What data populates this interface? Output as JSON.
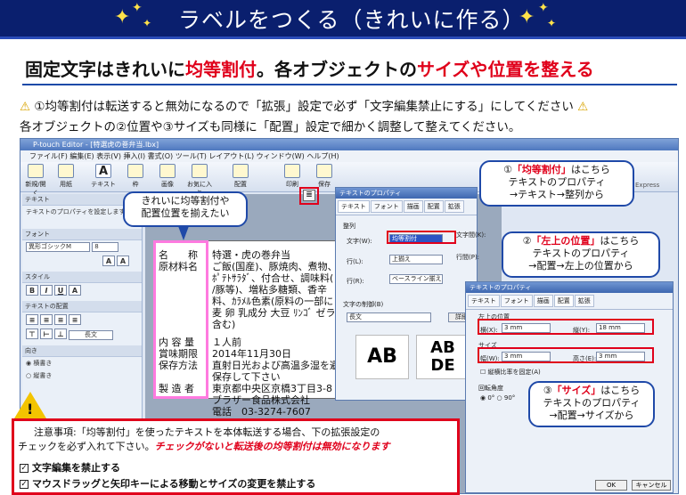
{
  "header": {
    "title": "ラベルをつくる（きれいに作る）"
  },
  "subtitle": {
    "part1": "固定文字はきれいに",
    "part2": "均等割付",
    "part3": "。各オブジェクトの",
    "part4": "サイズや位置を整える"
  },
  "warning": {
    "line1": "①均等割付は転送すると無効になるので「拡張」設定で必ず「文字編集禁止にする」にしてください",
    "line2": "各オブジェクトの②位置や③サイズも同様に「配置」設定で細かく調整して整えてください。"
  },
  "app": {
    "title": "P-touch Editor - [特選虎の巻弁当.lbx]",
    "menu": "ファイル(F)  編集(E)  表示(V)  挿入(I)  書式(O)  ツール(T)  レイアウト(L)  ウィンドウ(W)  ヘルプ(H)",
    "toolbar": [
      "新規/開く",
      "用紙",
      "テキスト",
      "枠",
      "画像",
      "お気に入り",
      "配置",
      "印刷",
      "保存"
    ],
    "toolbar_right": "Express",
    "sidebar": {
      "text_head": "テキスト",
      "text_desc": "テキストのプロパティを設定します",
      "font_head": "フォント",
      "font_name": "異形ゴシックM",
      "font_size": "8",
      "style_head": "スタイル",
      "align_head": "テキストの配置",
      "long": "長文",
      "dir_head": "向き",
      "dir1": "横書き",
      "dir2": "縦書き"
    },
    "label": {
      "c1": [
        "名　　称",
        "原材料名"
      ],
      "c2": [
        "特選・虎の巻弁当",
        "ご飯(国産)、豚焼肉、煮物、",
        "ﾎﾟﾃﾄｻﾗﾀﾞ、付合せ、調味料(",
        "/豚等)、増粘多糖類、香辛",
        "料、ｶﾗﾒﾙ色素(原料の一部に",
        "麦 卵 乳成分 大豆 ﾘﾝｺﾞ ゼラ",
        "含む)"
      ],
      "c3": [
        "内 容 量",
        "賞味期限",
        "保存方法",
        "",
        "製 造 者"
      ],
      "c4": [
        "１人前",
        "2014年11月30日",
        "直射日光および高温多湿を避",
        "保存して下さい",
        "東京都中央区京橋3丁目3-8",
        "ブラザー食品株式会社",
        "電話　03-3274-7607"
      ]
    }
  },
  "callouts": {
    "c0": "きれいに均等割付や\n配置位置を揃えたい",
    "c1_a": "①",
    "c1_b": "「均等割付」",
    "c1_c": "はこちら",
    "c1_d": "テキストのプロパティ",
    "c1_e": "→テキスト→整列から",
    "c2_a": "②",
    "c2_b": "「左上の位置」",
    "c2_c": "はこちら",
    "c2_d": "テキストのプロパティ",
    "c2_e": "→配置→左上の位置から",
    "c3_a": "③",
    "c3_b": "「サイズ」",
    "c3_c": "はこちら",
    "c3_d": "テキストのプロパティ",
    "c3_e": "→配置→サイズから"
  },
  "dialog1": {
    "title": "テキストのプロパティ",
    "tabs": [
      "テキスト",
      "フォント",
      "描画",
      "配置",
      "拡張"
    ],
    "align": "整列",
    "moji": "文字(W):",
    "moji_val": "均等割付",
    "gyo": "行(L):",
    "gyo_val": "上揃え",
    "retsu": "行(R):",
    "retsu_val": "ベースライン揃え",
    "ctrl": "文字の制御(B)",
    "ctrl_val": "長文",
    "detail": "詳細",
    "mojima": "文字間(K):",
    "gyoma": "行間(P):",
    "ab1": "AB",
    "ab2": "AB",
    "de": "DE"
  },
  "dialog2": {
    "title": "テキストのプロパティ",
    "tabs": [
      "テキスト",
      "フォント",
      "描画",
      "配置",
      "拡張"
    ],
    "pos": "左上の位置",
    "x": "横(X):",
    "x_val": "3 mm",
    "y": "縦(Y):",
    "y_val": "18 mm",
    "size": "サイズ",
    "w": "幅(W):",
    "w_val": "3 mm",
    "h": "高さ(E):",
    "h_val": "3 mm",
    "keep": "縦横比率を固定(A)",
    "rot": "回転角度",
    "rot0": "0°",
    "rot90": "90°",
    "cancel": "キャンセル",
    "ok": "OK"
  },
  "note": {
    "line1": "注意事項:「均等割付」を使ったテキストを本体転送する場合、下の拡張設定の",
    "line2a": "チェックを必ず入れて下さい。",
    "line2b": "チェックがないと転送後の均等割付は無効になります",
    "check1": "文字編集を禁止する",
    "check2": "マウスドラッグと矢印キーによる移動とサイズの変更を禁止する"
  }
}
